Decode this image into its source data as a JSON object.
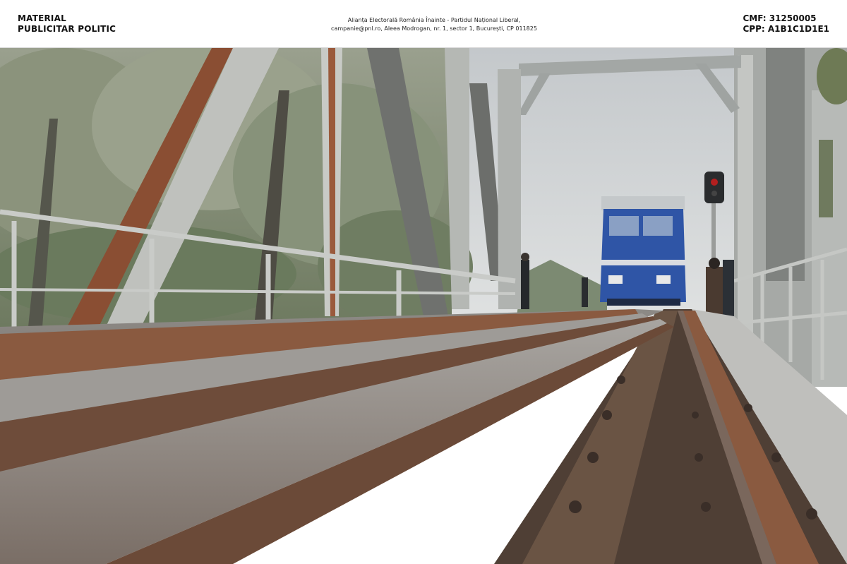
{
  "banner": {
    "left_line1": "MATERIAL",
    "left_line2": "PUBLICITAR POLITIC",
    "center_line1": "Alianța Electorală România Înainte - Partidul Național Liberal,",
    "center_line2": "campanie@pnl.ro, Aleea Modrogan, nr. 1, sector 1, București, CP 011825",
    "right_line1": "CMF: 31250005",
    "right_line2": "CPP: A1B1C1D1E1"
  },
  "photo": {
    "colors": {
      "sky": "#cfd2d4",
      "trees": "#7f8a72",
      "steel": "#b9bcb9",
      "rust": "#8a4e33",
      "rail_top": "#9b9895",
      "locomotive": "#2f55a6",
      "signal": "#2a2c2e"
    }
  }
}
